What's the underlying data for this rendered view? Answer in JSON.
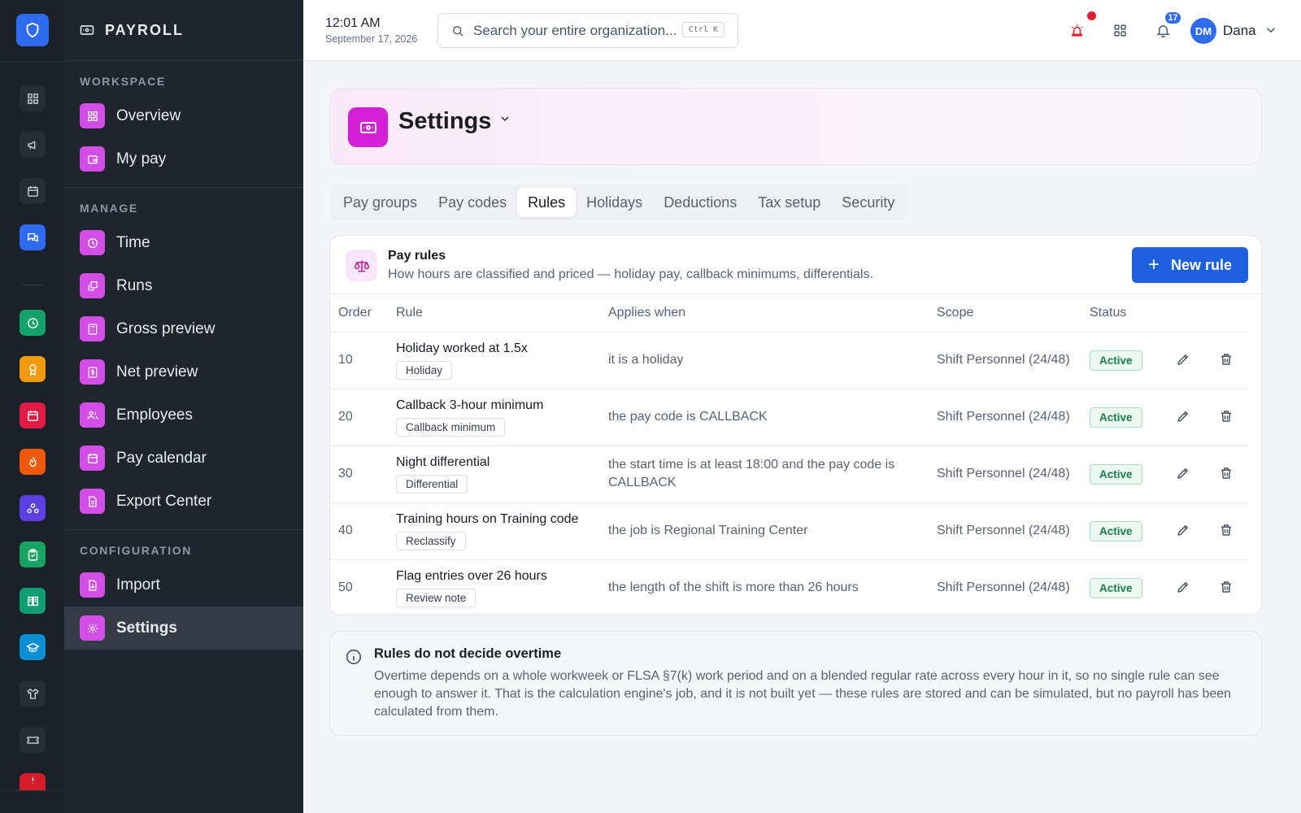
{
  "app": {
    "title": "PAYROLL"
  },
  "topbar": {
    "time": "12:01 AM",
    "date": "September 17, 2026",
    "search_placeholder": "Search your entire organization...",
    "search_shortcut": "Ctrl K",
    "notifications_count": "17",
    "user_initials": "DM",
    "user_name": "Dana"
  },
  "sidenav": {
    "sections": [
      {
        "label": "WORKSPACE",
        "items": [
          "Overview",
          "My pay"
        ]
      },
      {
        "label": "MANAGE",
        "items": [
          "Time",
          "Runs",
          "Gross preview",
          "Net preview",
          "Employees",
          "Pay calendar",
          "Export Center"
        ]
      },
      {
        "label": "CONFIGURATION",
        "items": [
          "Import",
          "Settings"
        ]
      }
    ],
    "active_item": "Settings"
  },
  "page": {
    "title": "Settings",
    "tabs": [
      "Pay groups",
      "Pay codes",
      "Rules",
      "Holidays",
      "Deductions",
      "Tax setup",
      "Security"
    ],
    "active_tab": "Rules"
  },
  "rules_card": {
    "title": "Pay rules",
    "subtitle": "How hours are classified and priced — holiday pay, callback minimums, differentials.",
    "new_button": "New rule",
    "columns": [
      "Order",
      "Rule",
      "Applies when",
      "Scope",
      "Status"
    ],
    "rows": [
      {
        "order": "10",
        "rule": "Holiday worked at 1.5x",
        "tag": "Holiday",
        "applies_when": "it is a holiday",
        "scope": "Shift Personnel (24/48)",
        "status": "Active"
      },
      {
        "order": "20",
        "rule": "Callback 3-hour minimum",
        "tag": "Callback minimum",
        "applies_when": "the pay code is CALLBACK",
        "scope": "Shift Personnel (24/48)",
        "status": "Active"
      },
      {
        "order": "30",
        "rule": "Night differential",
        "tag": "Differential",
        "applies_when": "the start time is at least 18:00 and the pay code is CALLBACK",
        "scope": "Shift Personnel (24/48)",
        "status": "Active"
      },
      {
        "order": "40",
        "rule": "Training hours on Training code",
        "tag": "Reclassify",
        "applies_when": "the job is Regional Training Center",
        "scope": "Shift Personnel (24/48)",
        "status": "Active"
      },
      {
        "order": "50",
        "rule": "Flag entries over 26 hours",
        "tag": "Review note",
        "applies_when": "the length of the shift is more than 26 hours",
        "scope": "Shift Personnel (24/48)",
        "status": "Active"
      }
    ]
  },
  "note": {
    "title": "Rules do not decide overtime",
    "body": "Overtime depends on a whole workweek or FLSA §7(k) work period and on a blended regular rate across every hour in it, so no single rule can see enough to answer it. That is the calculation engine's job, and it is not built yet — these rules are stored and can be simulated, but no payroll has been calculated from them."
  },
  "colors": {
    "accent": "#1e5fe0",
    "nav_icon": "#d24ee6",
    "settings_icon": "#d520d8",
    "status_active": "#17804b",
    "alert": "#e5202e"
  },
  "rail_icons": [
    "shield-icon",
    "dashboard-icon",
    "megaphone-icon",
    "calendar-icon",
    "chat-icon",
    "clock-icon",
    "award-icon",
    "calendar-icon",
    "flame-icon",
    "network-icon",
    "clipboard-icon",
    "book-icon",
    "graduation-icon",
    "shirt-icon",
    "ticket-icon",
    "alert-icon"
  ]
}
